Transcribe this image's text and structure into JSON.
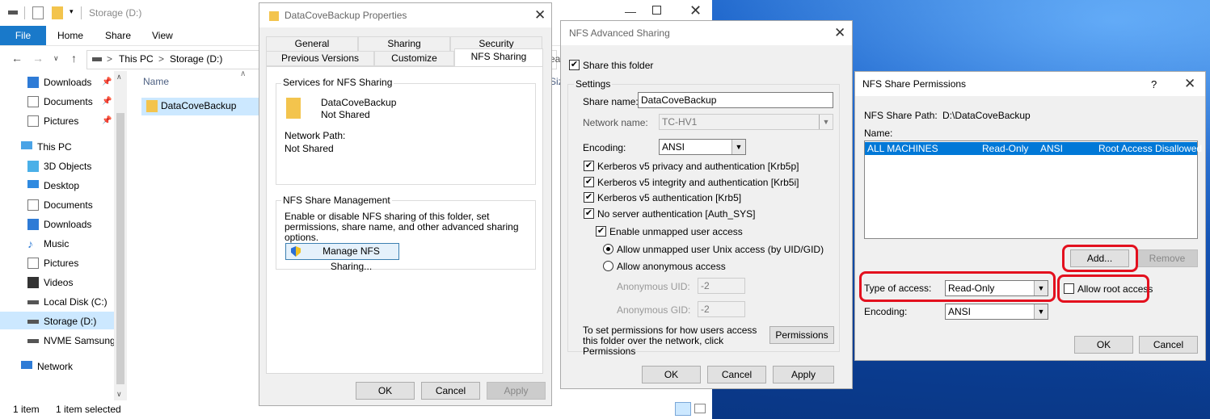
{
  "explorer": {
    "title": "Storage (D:)",
    "ribbon": {
      "file": "File",
      "tabs": [
        "Home",
        "Share",
        "View"
      ]
    },
    "address": {
      "crumbs": [
        "This PC",
        "Storage (D:)"
      ],
      "sep": ">"
    },
    "nav": [
      {
        "label": "Downloads",
        "icon": "download-icon",
        "pinned": true
      },
      {
        "label": "Documents",
        "icon": "documents-icon",
        "pinned": true
      },
      {
        "label": "Pictures",
        "icon": "pictures-icon",
        "pinned": true
      },
      {
        "label": "This PC",
        "icon": "computer-icon"
      },
      {
        "label": "3D Objects",
        "icon": "3d-objects-icon"
      },
      {
        "label": "Desktop",
        "icon": "desktop-icon"
      },
      {
        "label": "Documents",
        "icon": "documents-icon"
      },
      {
        "label": "Downloads",
        "icon": "download-icon"
      },
      {
        "label": "Music",
        "icon": "music-icon"
      },
      {
        "label": "Pictures",
        "icon": "pictures-icon"
      },
      {
        "label": "Videos",
        "icon": "videos-icon"
      },
      {
        "label": "Local Disk (C:)",
        "icon": "drive-icon"
      },
      {
        "label": "Storage (D:)",
        "icon": "drive-icon"
      },
      {
        "label": "NVME Samsung",
        "icon": "drive-icon"
      },
      {
        "label": "Network",
        "icon": "network-icon"
      }
    ],
    "column_name": "Name",
    "column_size_partial": "Siz",
    "column_partial_2": "ea",
    "file": "DataCoveBackup",
    "status": {
      "count": "1 item",
      "selected": "1 item selected"
    }
  },
  "props": {
    "title": "DataCoveBackup Properties",
    "tabs_row1": [
      "General",
      "Sharing",
      "Security"
    ],
    "tabs_row2": [
      "Previous Versions",
      "Customize",
      "NFS Sharing"
    ],
    "services_group": "Services for NFS Sharing",
    "folder_name": "DataCoveBackup",
    "share_state": "Not Shared",
    "network_path_label": "Network Path:",
    "network_path_value": "Not Shared",
    "mgmt_group": "NFS Share Management",
    "mgmt_desc": "Enable or disable NFS sharing of this folder, set permissions, share name, and other advanced sharing options.",
    "manage_button": "Manage NFS Sharing...",
    "ok": "OK",
    "cancel": "Cancel",
    "apply": "Apply"
  },
  "advanced": {
    "title": "NFS Advanced Sharing",
    "share_folder": "Share this folder",
    "settings_group": "Settings",
    "share_name_label": "Share name:",
    "share_name_value": "DataCoveBackup",
    "network_name_label": "Network name:",
    "network_name_value": "TC-HV1",
    "encoding_label": "Encoding:",
    "encoding_value": "ANSI",
    "auth": [
      "Kerberos v5 privacy and authentication [Krb5p]",
      "Kerberos v5 integrity and authentication [Krb5i]",
      "Kerberos v5 authentication [Krb5]",
      "No server authentication [Auth_SYS]"
    ],
    "unmapped": "Enable unmapped user access",
    "allow_unix": "Allow unmapped user Unix access (by UID/GID)",
    "allow_anon": "Allow anonymous access",
    "anon_uid_label": "Anonymous UID:",
    "anon_uid_value": "-2",
    "anon_gid_label": "Anonymous GID:",
    "anon_gid_value": "-2",
    "perm_desc": "To set permissions for how users access this folder over the network, click Permissions",
    "permissions_button": "Permissions",
    "ok": "OK",
    "cancel": "Cancel",
    "apply": "Apply"
  },
  "perms": {
    "title": "NFS Share Permissions",
    "help": "?",
    "path_label": "NFS Share Path:",
    "path_value": "D:\\DataCoveBackup",
    "name_label": "Name:",
    "row": {
      "name": "ALL MACHINES",
      "access": "Read-Only",
      "encoding": "ANSI",
      "root": "Root Access Disallowed"
    },
    "add": "Add...",
    "remove": "Remove",
    "type_label": "Type of access:",
    "type_value": "Read-Only",
    "allow_root": "Allow root access",
    "encoding_label": "Encoding:",
    "encoding_value": "ANSI",
    "ok": "OK",
    "cancel": "Cancel"
  },
  "colors": {
    "selection": "#0078d7",
    "highlight_ring": "#e3101e",
    "file_tab": "#1979ca"
  }
}
